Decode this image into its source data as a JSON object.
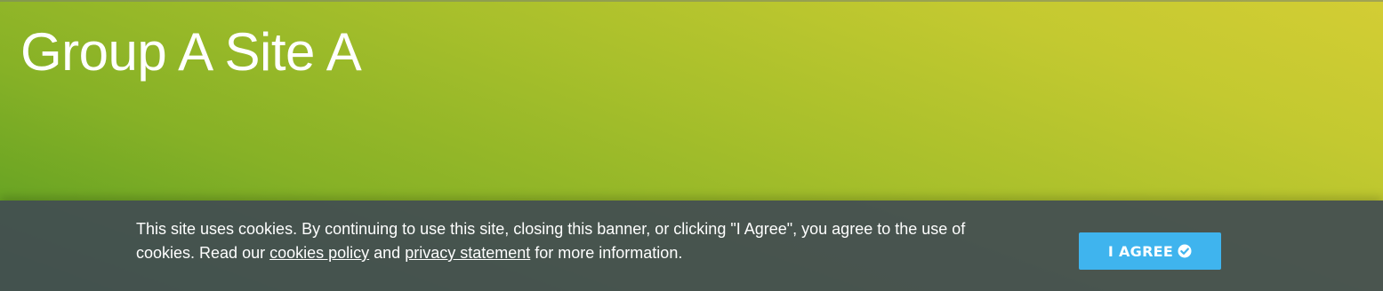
{
  "header": {
    "site_title": "Group A Site A"
  },
  "cookie_banner": {
    "text_before": "This site uses cookies. By continuing to use this site, closing this banner, or clicking \"I Agree\", you agree to the use of cookies. Read our ",
    "cookies_policy_link": "cookies policy",
    "text_between": " and ",
    "privacy_statement_link": "privacy statement",
    "text_after": " for more information.",
    "agree_button_label": "I AGREE",
    "agree_icon": "check-circle-icon"
  },
  "colors": {
    "hero_gradient_start": "#559b22",
    "hero_gradient_end": "#d3cd34",
    "banner_background": "#424c52",
    "agree_button": "#3fb4ee",
    "text": "#ffffff"
  }
}
